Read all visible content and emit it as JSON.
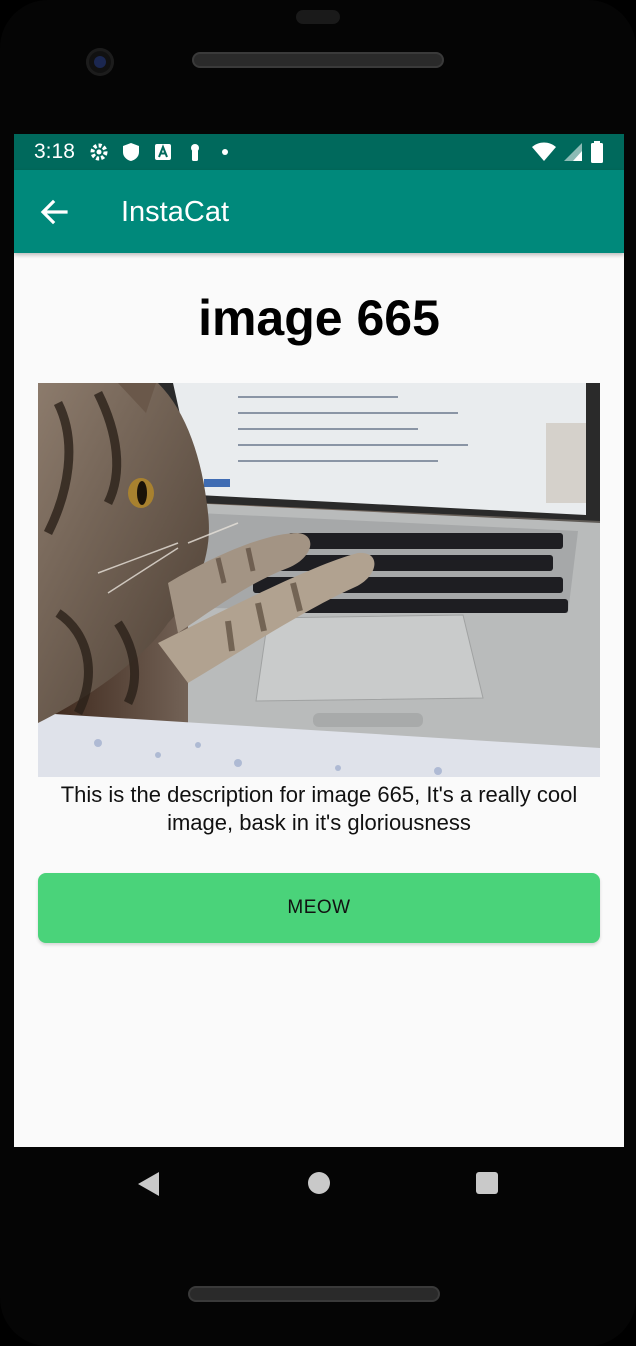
{
  "status_bar": {
    "time": "3:18",
    "left_icons": [
      "gear-icon",
      "shield-icon",
      "a-icon",
      "keyhole-icon",
      "dot-icon"
    ],
    "right_icons": [
      "wifi-icon",
      "signal-icon",
      "battery-icon"
    ]
  },
  "app_bar": {
    "title": "InstaCat",
    "back_icon": "arrow-left-icon",
    "background": "#00897b",
    "status_background": "#00695c"
  },
  "detail": {
    "title": "image 665",
    "description": "This is the description for image 665, It's a really cool image, bask in it's gloriousness",
    "button_label": "MEOW",
    "button_color": "#4ad37a"
  },
  "nav_bar": {
    "icons": [
      "nav-back-icon",
      "nav-home-icon",
      "nav-recents-icon"
    ]
  }
}
